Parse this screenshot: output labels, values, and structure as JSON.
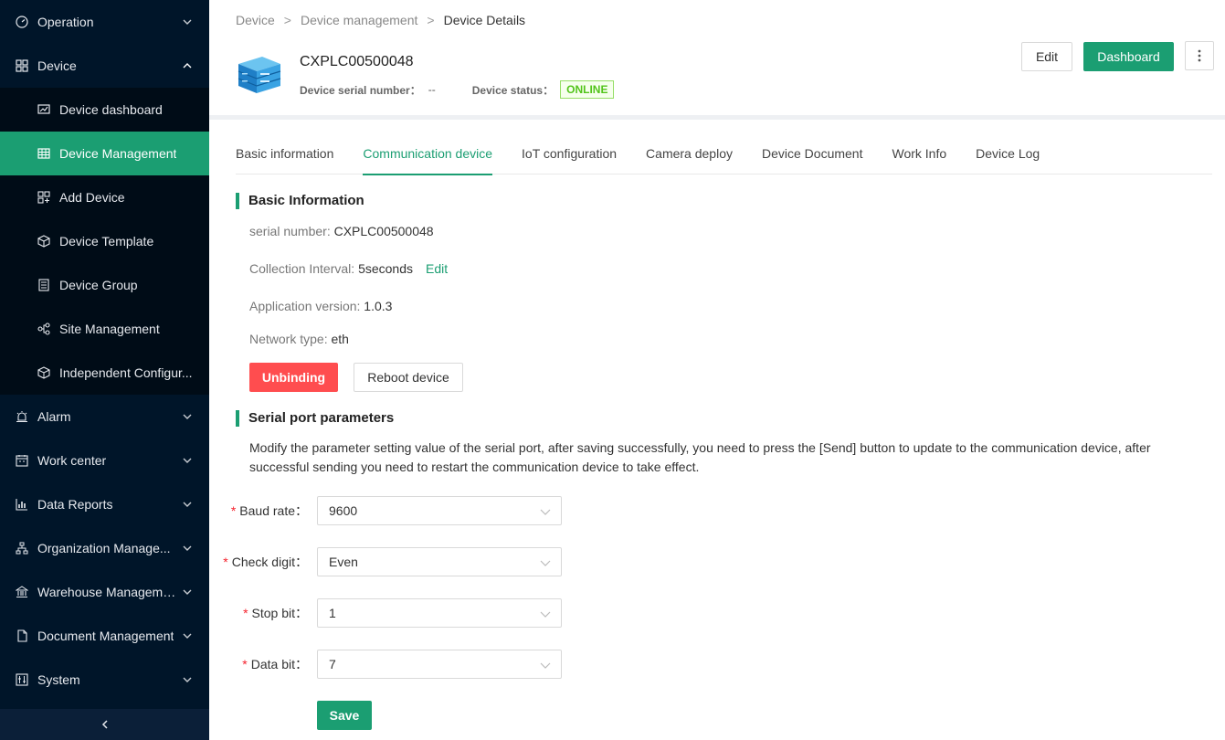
{
  "sidebar": {
    "items": [
      {
        "label": "Operation",
        "icon": "dashboard-gauge-icon"
      },
      {
        "label": "Device",
        "icon": "grid-apps-icon"
      },
      {
        "label": "Alarm",
        "icon": "alarm-bell-icon"
      },
      {
        "label": "Work center",
        "icon": "calendar-icon"
      },
      {
        "label": "Data Reports",
        "icon": "bar-chart-icon"
      },
      {
        "label": "Organization Manage...",
        "icon": "org-tree-icon"
      },
      {
        "label": "Warehouse Manageme...",
        "icon": "bank-icon"
      },
      {
        "label": "Document Management",
        "icon": "file-icon"
      },
      {
        "label": "System",
        "icon": "settings-sliders-icon"
      }
    ],
    "device_sub": [
      {
        "label": "Device dashboard",
        "icon": "monitor-chart-icon"
      },
      {
        "label": "Device Management",
        "icon": "table-icon"
      },
      {
        "label": "Add Device",
        "icon": "add-grid-icon"
      },
      {
        "label": "Device Template",
        "icon": "template-cube-icon"
      },
      {
        "label": "Device Group",
        "icon": "group-list-icon"
      },
      {
        "label": "Site Management",
        "icon": "nodes-icon"
      },
      {
        "label": "Independent Configur...",
        "icon": "box-icon"
      }
    ],
    "collapse_icon": "chevron-left-icon"
  },
  "breadcrumb": [
    "Device",
    "Device management",
    "Device Details"
  ],
  "device": {
    "name": "CXPLC00500048",
    "serial_label": "Device serial number：",
    "serial_value": "--",
    "status_label": "Device status：",
    "status_value": "ONLINE",
    "status_color": "#52c41a"
  },
  "header_actions": {
    "edit": "Edit",
    "dashboard": "Dashboard",
    "more_icon": "more-vertical-icon"
  },
  "tabs": [
    {
      "label": "Basic information",
      "active": false
    },
    {
      "label": "Communication device",
      "active": true
    },
    {
      "label": "IoT configuration",
      "active": false
    },
    {
      "label": "Camera deploy",
      "active": false
    },
    {
      "label": "Device Document",
      "active": false
    },
    {
      "label": "Work Info",
      "active": false
    },
    {
      "label": "Device Log",
      "active": false
    }
  ],
  "basic_info": {
    "title": "Basic Information",
    "serial_label": "serial number: ",
    "serial_value": "CXPLC00500048",
    "interval_label": "Collection Interval: ",
    "interval_value": "5seconds",
    "interval_edit": "Edit",
    "app_version_label": "Application version: ",
    "app_version_value": "1.0.3",
    "network_label": "Network type: ",
    "network_value": "eth",
    "unbinding": "Unbinding",
    "reboot": "Reboot device"
  },
  "serial_params": {
    "title": "Serial port parameters",
    "description": "Modify the parameter setting value of the serial port, after saving successfully, you need to press the [Send] button to update to the communication device, after successful sending you need to restart the communication device to take effect.",
    "fields": [
      {
        "label": "Baud rate：",
        "value": "9600"
      },
      {
        "label": "Check digit：",
        "value": "Even"
      },
      {
        "label": "Stop bit：",
        "value": "1"
      },
      {
        "label": "Data bit：",
        "value": "7"
      }
    ],
    "required_mark": "*",
    "save": "Save"
  },
  "colors": {
    "accent": "#1b9e72",
    "sidebar_bg": "#001529",
    "danger": "#ff4d4f"
  }
}
